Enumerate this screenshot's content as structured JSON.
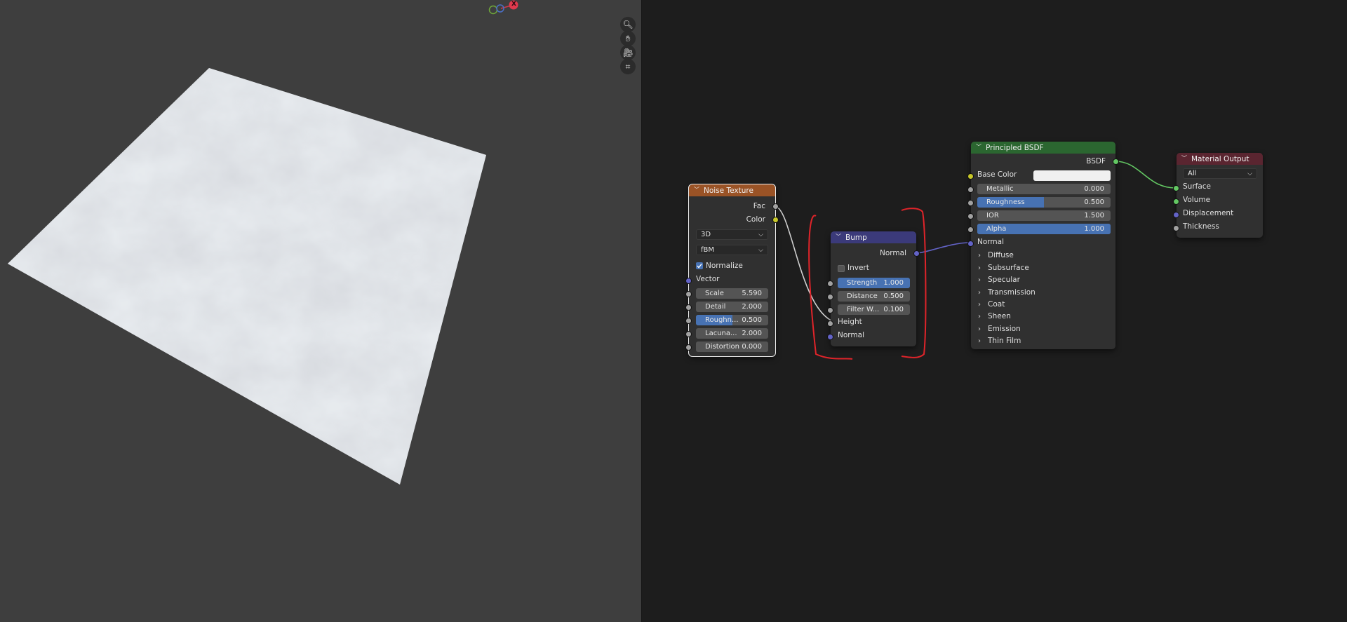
{
  "viewport": {
    "gizmo_x_label": "X",
    "tools": [
      {
        "icon": "zoom-icon",
        "glyph": "🔍︎"
      },
      {
        "icon": "hand-icon",
        "glyph": "✋︎"
      },
      {
        "icon": "camera-icon",
        "glyph": "🎥︎"
      },
      {
        "icon": "grid-icon",
        "glyph": "⌗"
      }
    ]
  },
  "noise": {
    "title": "Noise Texture",
    "out_fac": "Fac",
    "out_color": "Color",
    "dim": "3D",
    "type": "fBM",
    "normalize": "Normalize",
    "vector": "Vector",
    "fields": [
      {
        "label": "Scale",
        "value": "5.590"
      },
      {
        "label": "Detail",
        "value": "2.000"
      },
      {
        "label": "Roughn...",
        "value": "0.500"
      },
      {
        "label": "Lacuna...",
        "value": "2.000"
      },
      {
        "label": "Distortion",
        "value": "0.000"
      }
    ]
  },
  "bump": {
    "title": "Bump",
    "out_normal": "Normal",
    "invert": "Invert",
    "fields": [
      {
        "label": "Strength",
        "value": "1.000"
      },
      {
        "label": "Distance",
        "value": "0.500"
      },
      {
        "label": "Filter W...",
        "value": "0.100"
      }
    ],
    "height": "Height",
    "normal": "Normal"
  },
  "bsdf": {
    "title": "Principled BSDF",
    "out_bsdf": "BSDF",
    "base_color": "Base Color",
    "fields": [
      {
        "label": "Metallic",
        "value": "0.000",
        "fill": 0
      },
      {
        "label": "Roughness",
        "value": "0.500",
        "fill": 0.5
      },
      {
        "label": "IOR",
        "value": "1.500",
        "fill": 0
      },
      {
        "label": "Alpha",
        "value": "1.000",
        "fill": 1
      }
    ],
    "normal": "Normal",
    "panels": [
      "Diffuse",
      "Subsurface",
      "Specular",
      "Transmission",
      "Coat",
      "Sheen",
      "Emission",
      "Thin Film"
    ]
  },
  "output": {
    "title": "Material Output",
    "target": "All",
    "inputs": [
      "Surface",
      "Volume",
      "Displacement",
      "Thickness"
    ]
  },
  "colors": {
    "noise_header": "#9a5326",
    "bump_header": "#3b3a7a",
    "bsdf_header": "#2b6630",
    "output_header": "#5a2530",
    "link_white": "#d0d0d0",
    "link_blue": "#6363c7",
    "link_green": "#63c763",
    "annotation_red": "#e0242a"
  }
}
